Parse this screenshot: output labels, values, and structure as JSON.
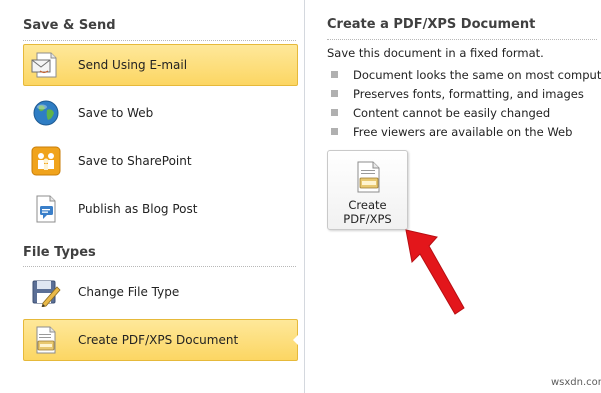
{
  "left": {
    "save_send_heading": "Save & Send",
    "save_items": [
      {
        "label": "Send Using E-mail",
        "icon": "email-icon",
        "selected": true
      },
      {
        "label": "Save to Web",
        "icon": "globe-icon"
      },
      {
        "label": "Save to SharePoint",
        "icon": "sharepoint-icon"
      },
      {
        "label": "Publish as Blog Post",
        "icon": "blog-post-icon"
      }
    ],
    "file_types_heading": "File Types",
    "file_type_items": [
      {
        "label": "Change File Type",
        "icon": "change-file-type-icon"
      },
      {
        "label": "Create PDF/XPS Document",
        "icon": "pdf-xps-document-icon",
        "selected": true
      }
    ]
  },
  "right": {
    "title": "Create a PDF/XPS Document",
    "description": "Save this document in a fixed format.",
    "bullets": [
      "Document looks the same on most computers",
      "Preserves fonts, formatting, and images",
      "Content cannot be easily changed",
      "Free viewers are available on the Web"
    ],
    "create_button": {
      "label": "Create\nPDF/XPS",
      "icon": "pdf-xps-document-icon"
    }
  },
  "annotation": {
    "icon": "red-arrow-icon",
    "color": "#e3161b"
  },
  "watermark": "wsxdn.com",
  "colors": {
    "selected_fill": "#fcd663",
    "selected_border": "#e6b93a",
    "heading": "#404040",
    "divider": "#d4d8de"
  }
}
